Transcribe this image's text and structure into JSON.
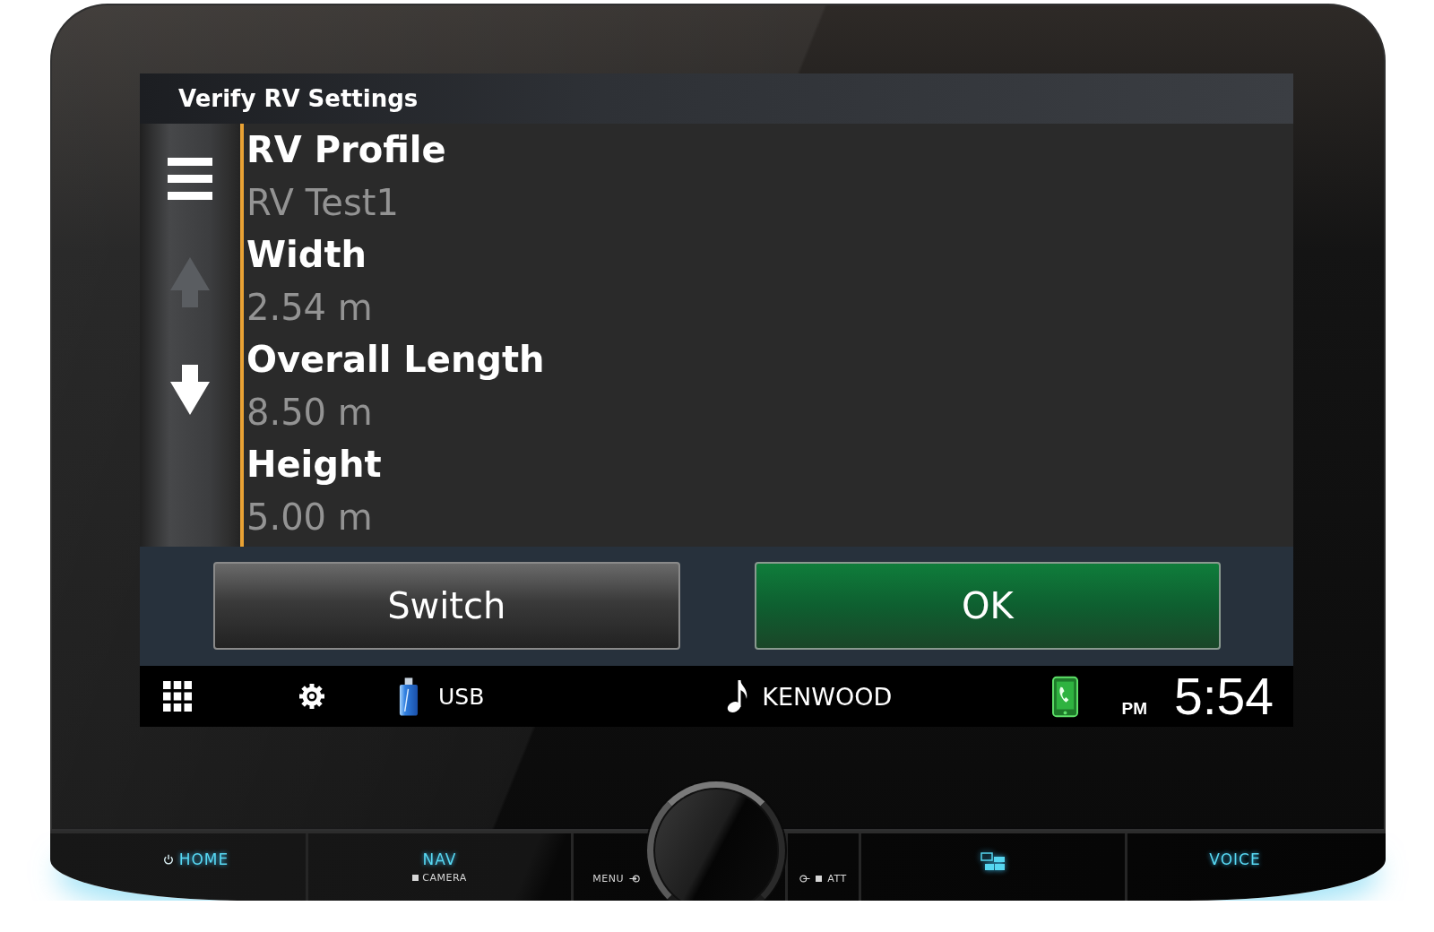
{
  "screen": {
    "title": "Verify RV Settings",
    "sidebar": [
      {
        "kind": "menu",
        "disabled": false
      },
      {
        "kind": "up",
        "disabled": true
      },
      {
        "kind": "down",
        "disabled": false
      }
    ],
    "settings": [
      {
        "label": "RV Profile",
        "value": "RV Test1"
      },
      {
        "label": "Width",
        "value": "2.54 m"
      },
      {
        "label": "Overall Length",
        "value": "8.50 m"
      },
      {
        "label": "Height",
        "value": "5.00 m"
      }
    ],
    "actions": [
      {
        "label": "Switch",
        "kind": "secondary"
      },
      {
        "label": "OK",
        "kind": "primary"
      }
    ],
    "status_bar": {
      "source": "USB",
      "now_playing": "KENWOOD",
      "phone_connected": true,
      "meridiem": "PM",
      "time": "5:54"
    }
  },
  "hardware_buttons": [
    {
      "kind": "home",
      "label": "HOME"
    },
    {
      "kind": "nav",
      "label": "NAV",
      "sublabel": "CAMERA"
    },
    {
      "kind": "menu",
      "label": "MENU"
    },
    {
      "kind": "att",
      "label": "ATT"
    },
    {
      "kind": "screen"
    },
    {
      "kind": "voice",
      "label": "VOICE"
    }
  ]
}
